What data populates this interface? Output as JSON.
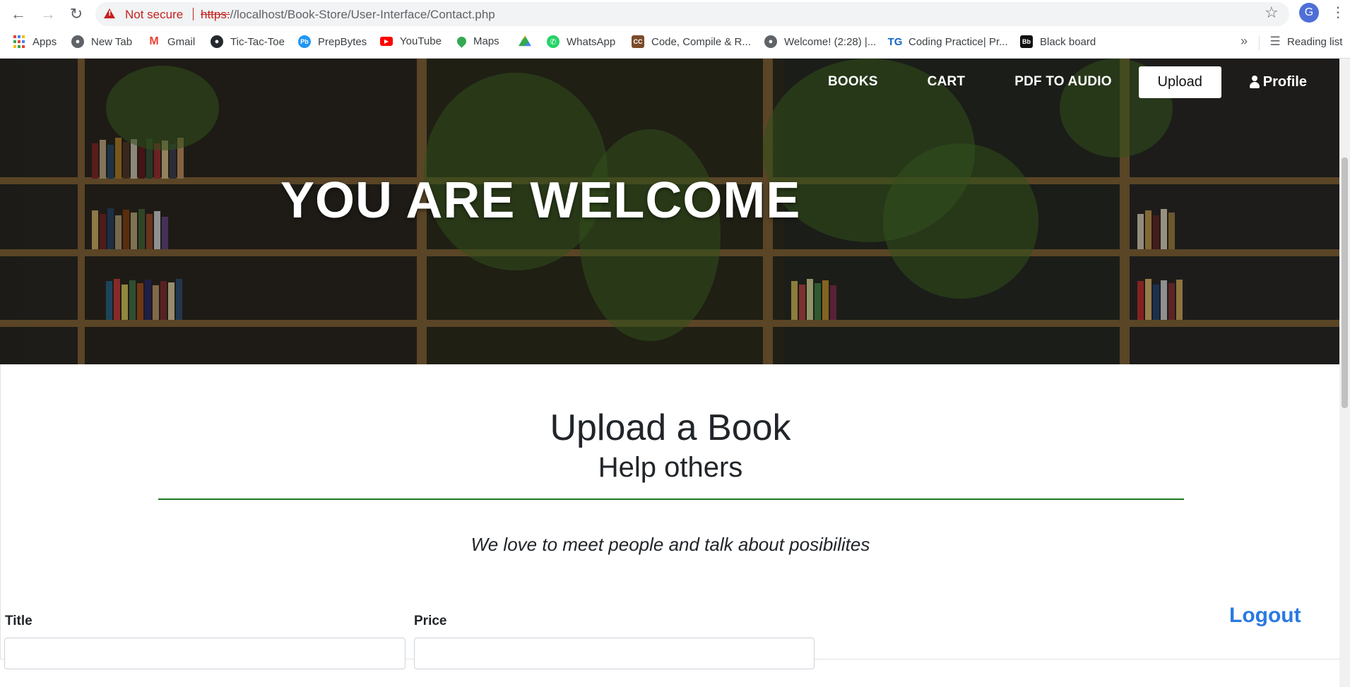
{
  "browser": {
    "security_text": "Not secure",
    "url_scheme": "https:",
    "url_rest": "//localhost/Book-Store/User-Interface/Contact.php",
    "profile_initial": "G"
  },
  "bookmarks": [
    {
      "label": "Apps",
      "icon": "apps-grid-icon"
    },
    {
      "label": "New Tab",
      "icon": "globe-icon"
    },
    {
      "label": "Gmail",
      "icon": "gmail-icon"
    },
    {
      "label": "Tic-Tac-Toe",
      "icon": "github-icon"
    },
    {
      "label": "PrepBytes",
      "icon": "prepbytes-icon"
    },
    {
      "label": "YouTube",
      "icon": "youtube-icon"
    },
    {
      "label": "Maps",
      "icon": "maps-pin-icon"
    },
    {
      "label": "",
      "icon": "google-drive-icon"
    },
    {
      "label": "WhatsApp",
      "icon": "whatsapp-icon"
    },
    {
      "label": "Code, Compile & R...",
      "icon": "codechef-icon"
    },
    {
      "label": "Welcome! (2:28) |...",
      "icon": "globe-icon"
    },
    {
      "label": "Coding Practice| Pr...",
      "icon": "tg-icon"
    },
    {
      "label": "Black board",
      "icon": "blackboard-icon"
    }
  ],
  "bookmarks_more": "»",
  "reading_list": "Reading list",
  "nav": {
    "books": "BOOKS",
    "cart": "CART",
    "pdf_to_audio": "PDF TO AUDIO",
    "upload": "Upload",
    "profile": "Profile"
  },
  "hero": {
    "title": "YOU ARE WELCOME"
  },
  "intro": {
    "heading": "Upload a Book",
    "subheading": "Help others",
    "tagline": "We love to meet people and talk about posibilites"
  },
  "form": {
    "title_label": "Title",
    "title_value": "",
    "price_label": "Price",
    "price_value": ""
  },
  "logout": "Logout",
  "colors": {
    "divider": "#1e7a1e",
    "logout": "#2a7ae2",
    "warning": "#c5221f"
  }
}
